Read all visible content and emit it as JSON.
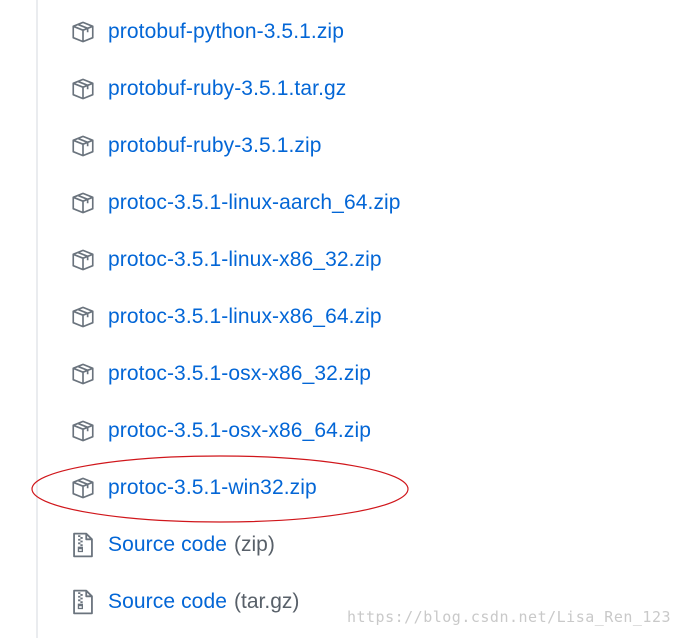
{
  "assets": [
    {
      "label": "protobuf-python-3.5.1.zip",
      "icon": "package-icon"
    },
    {
      "label": "protobuf-ruby-3.5.1.tar.gz",
      "icon": "package-icon"
    },
    {
      "label": "protobuf-ruby-3.5.1.zip",
      "icon": "package-icon"
    },
    {
      "label": "protoc-3.5.1-linux-aarch_64.zip",
      "icon": "package-icon"
    },
    {
      "label": "protoc-3.5.1-linux-x86_32.zip",
      "icon": "package-icon"
    },
    {
      "label": "protoc-3.5.1-linux-x86_64.zip",
      "icon": "package-icon"
    },
    {
      "label": "protoc-3.5.1-osx-x86_32.zip",
      "icon": "package-icon"
    },
    {
      "label": "protoc-3.5.1-osx-x86_64.zip",
      "icon": "package-icon"
    },
    {
      "label": "protoc-3.5.1-win32.zip",
      "icon": "package-icon"
    }
  ],
  "source": [
    {
      "label": "Source code",
      "suffix": "(zip)",
      "icon": "file-zip-icon"
    },
    {
      "label": "Source code",
      "suffix": "(tar.gz)",
      "icon": "file-zip-icon"
    }
  ],
  "watermark": "https://blog.csdn.net/Lisa_Ren_123",
  "colors": {
    "link": "#0366d6",
    "muted": "#586069",
    "icon": "#6a737d",
    "annotation": "#d0161b"
  }
}
